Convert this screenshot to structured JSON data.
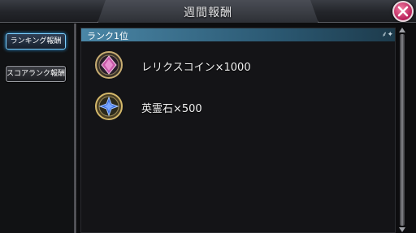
{
  "header": {
    "title": "週間報酬"
  },
  "sidebar": {
    "tabs": [
      {
        "label": "ランキング報酬",
        "active": true
      },
      {
        "label": "スコアランク報酬",
        "active": false
      }
    ]
  },
  "panel": {
    "header_label": "ランク1位",
    "rewards": [
      {
        "icon": "relics-coin-icon",
        "text": "レリクスコイン×1000"
      },
      {
        "icon": "spirit-stone-icon",
        "text": "英霊石×500"
      }
    ]
  },
  "colors": {
    "accent_active": "#7fd0ff",
    "panel_header": "#4a86a6",
    "close_button": "#d0356f"
  }
}
